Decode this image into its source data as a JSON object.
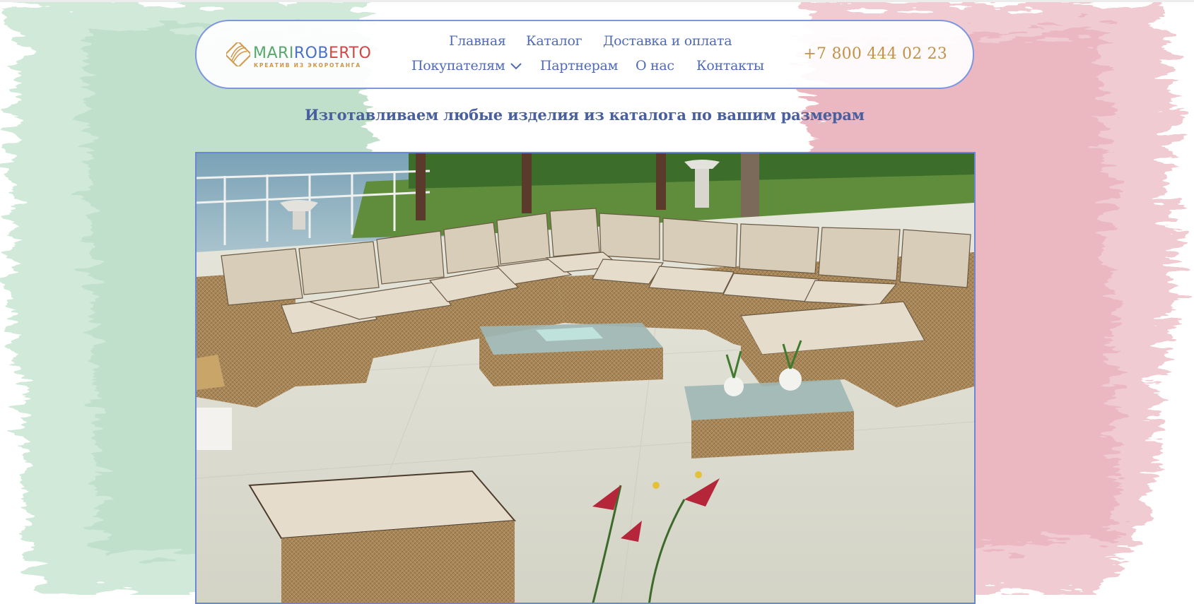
{
  "colors": {
    "accent_blue": "#4f6bb8",
    "border_blue": "#7e96e0",
    "phone_gold": "#c1924a",
    "flag_green": "#b9dcc6",
    "flag_red": "#e9b1bb"
  },
  "logo": {
    "part1": "MARI",
    "part2": "ROB",
    "part3": "ERTO",
    "subtitle": "КРЕАТИВ ИЗ ЭКОРОТАНГА",
    "icon": "rattan-leaf-icon"
  },
  "nav": {
    "row1": [
      "Главная",
      "Каталог",
      "Доставка и оплата"
    ],
    "row2": [
      "Покупателям",
      "Партнерам",
      "О нас",
      "Контакты"
    ],
    "dropdown_icon": "chevron-down-icon"
  },
  "phone": "+7 800 444 02 23",
  "tagline": "Изготавливаем любые изделия из каталога по вашим размерам",
  "hero": {
    "subject": "modular-rattan-sofa-photo"
  }
}
